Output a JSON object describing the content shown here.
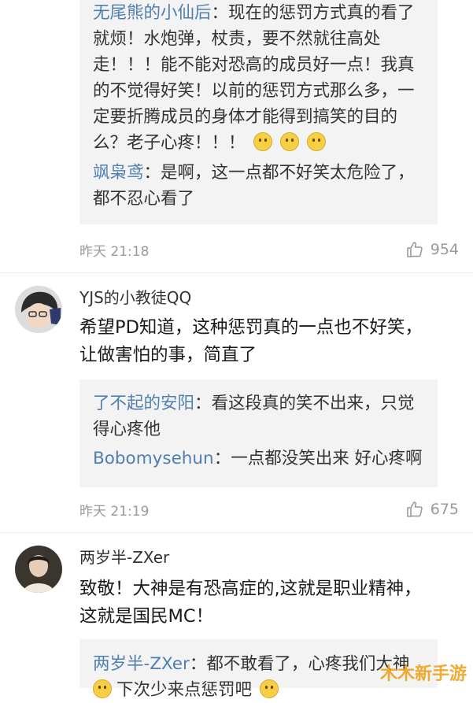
{
  "thread1": {
    "replies": [
      {
        "user": "无尾熊的小仙后",
        "lines": [
          "：现在的惩罚方式真的看了",
          "就烦！水炮弹，杖责，要不然就往高处",
          "走！！！能不能对恐高的成员好一点！我真",
          "的不觉得好笑！以前的惩罚方式那么多，一",
          "定要折腾成员的身体才能得到搞笑的目的",
          "么？老子心疼！！！"
        ]
      },
      {
        "user": "飒枭鸢",
        "lines": [
          "：是啊，这一点都不好笑太危险了，",
          "都不忍心看了"
        ]
      }
    ],
    "time": "昨天 21:18",
    "likes": "954"
  },
  "comment2": {
    "author": "YJS的小教徒QQ",
    "content": [
      "希望PD知道，这种惩罚真的一点也不好笑，",
      "让做害怕的事，简直了"
    ],
    "replies": [
      {
        "user": "了不起的安阳",
        "lines": [
          "：看这段真的笑不出来，只觉",
          "得心疼他"
        ]
      },
      {
        "user": "Bobomysehun",
        "lines": [
          "：一点都没笑出来 好心疼啊"
        ]
      }
    ],
    "time": "昨天 21:19",
    "likes": "675"
  },
  "comment3": {
    "author": "两岁半-ZXer",
    "content": [
      "致敬！大神是有恐高症的,这就是职业精神，",
      "这就是国民MC！"
    ],
    "replies": [
      {
        "user": "两岁半-ZXer",
        "lines": [
          "：都不敢看了，心疼我们大神",
          "下次少来点惩罚吧"
        ]
      }
    ]
  },
  "watermark": "木木新手游",
  "icons": {
    "like": "thumbs-up-icon",
    "emoji": "smile-emoji-icon"
  }
}
